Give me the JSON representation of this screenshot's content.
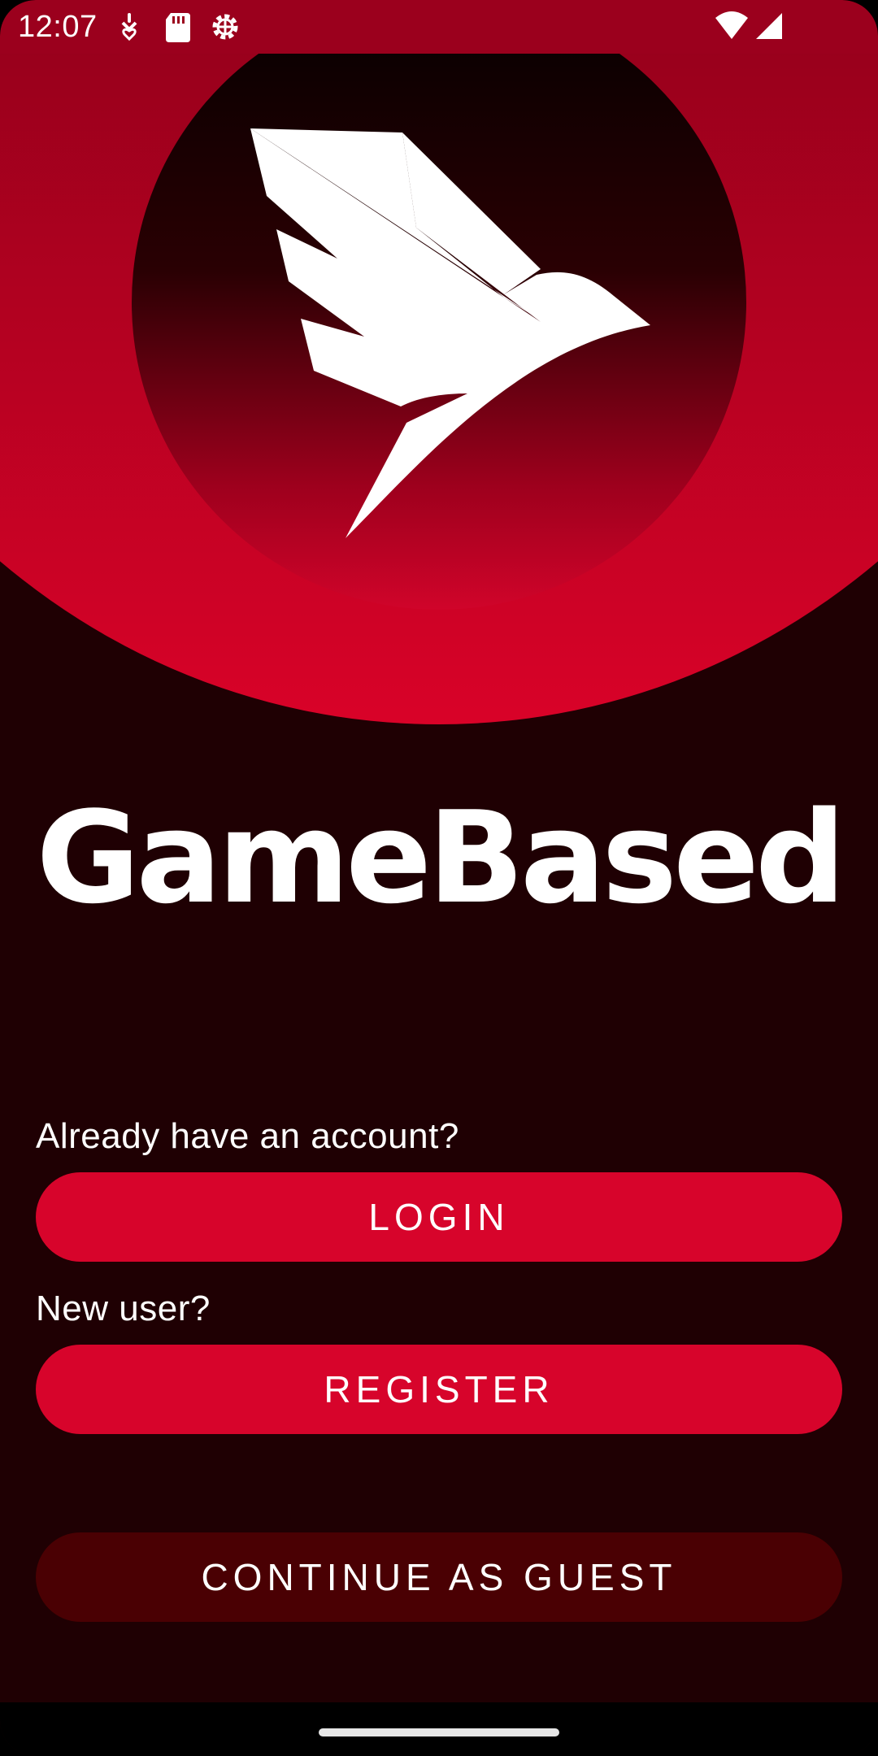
{
  "status_bar": {
    "time": "12:07",
    "icons": [
      "heart-pin-icon",
      "sd-card-icon",
      "settings-gear-icon",
      "wifi-icon",
      "signal-icon"
    ]
  },
  "hero": {
    "logo_icon": "bird-logo-icon",
    "colors": {
      "accent": "#d7042b",
      "dark": "#1f0003",
      "circle_top": "#050000"
    }
  },
  "app": {
    "title": "GameBased"
  },
  "auth": {
    "login_prompt": "Already have an account?",
    "login_label": "LOGIN",
    "register_prompt": "New user?",
    "register_label": "REGISTER",
    "guest_label": "CONTINUE AS GUEST"
  },
  "colors": {
    "background": "#1f0003",
    "button_primary": "#d7042b",
    "button_guest": "#4a0003",
    "status_bar": "#9b001d"
  }
}
